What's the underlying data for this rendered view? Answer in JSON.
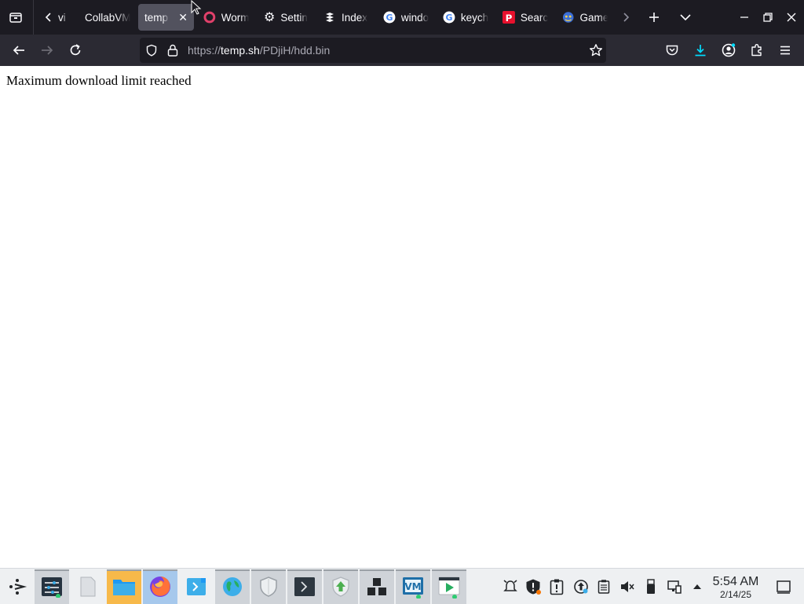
{
  "browser": {
    "tabs": [
      {
        "label": "vi",
        "favicon": "none"
      },
      {
        "label": "CollabVM",
        "favicon": "none"
      },
      {
        "label": "temp",
        "favicon": "none",
        "active": true
      },
      {
        "label": "Worm",
        "favicon": "worm-icon"
      },
      {
        "label": "Settin",
        "favicon": "gear-icon"
      },
      {
        "label": "Index",
        "favicon": "index-icon"
      },
      {
        "label": "windo",
        "favicon": "google-icon"
      },
      {
        "label": "keych",
        "favicon": "google-icon"
      },
      {
        "label": "Searc",
        "favicon": "search-p-icon"
      },
      {
        "label": "Game",
        "favicon": "game-icon"
      }
    ],
    "url": {
      "scheme": "https://",
      "host": "temp.sh",
      "path": "/PDjiH/hdd.bin"
    }
  },
  "page": {
    "message": "Maximum download limit reached"
  },
  "taskbar": {
    "clock": {
      "time": "5:54 AM",
      "date": "2/14/25"
    }
  },
  "colors": {
    "tabbar_bg": "#1c1b22",
    "navbar_bg": "#2b2a33",
    "urlbar_bg": "#1c1b22",
    "accent_download": "#00ddff",
    "taskbar_bg": "#eef0f2"
  }
}
